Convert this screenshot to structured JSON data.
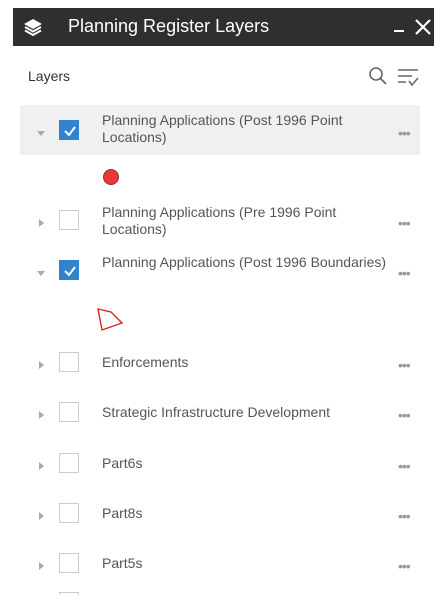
{
  "panel": {
    "title": "Planning Register Layers",
    "icon": "layers-icon",
    "minimize_icon": "minimize-icon",
    "close_icon": "close-icon",
    "header_color": "#2f2f2f"
  },
  "toolbar": {
    "label": "Layers",
    "search_icon": "search-icon",
    "filter_icon": "filter-icon"
  },
  "more_glyph": "•••",
  "layers": [
    {
      "label": "Planning Applications (Post 1996 Point Locations)",
      "checked": true,
      "expanded": true,
      "legend": "red-circle"
    },
    {
      "label": "Planning Applications (Pre 1996 Point Locations)",
      "checked": false,
      "expanded": false
    },
    {
      "label": "Planning Applications (Post 1996 Boundaries)",
      "checked": true,
      "expanded": true,
      "legend": "red-polygon-outline"
    },
    {
      "label": "Enforcements",
      "checked": false,
      "expanded": false
    },
    {
      "label": "Strategic Infrastructure Development",
      "checked": false,
      "expanded": false
    },
    {
      "label": "Part6s",
      "checked": false,
      "expanded": false
    },
    {
      "label": "Part8s",
      "checked": false,
      "expanded": false
    },
    {
      "label": "Part5s",
      "checked": false,
      "expanded": false
    }
  ],
  "colors": {
    "checkbox_checked": "#3083cc",
    "legend_red": "#e8383b",
    "row_highlight": "#f0f0f0"
  }
}
